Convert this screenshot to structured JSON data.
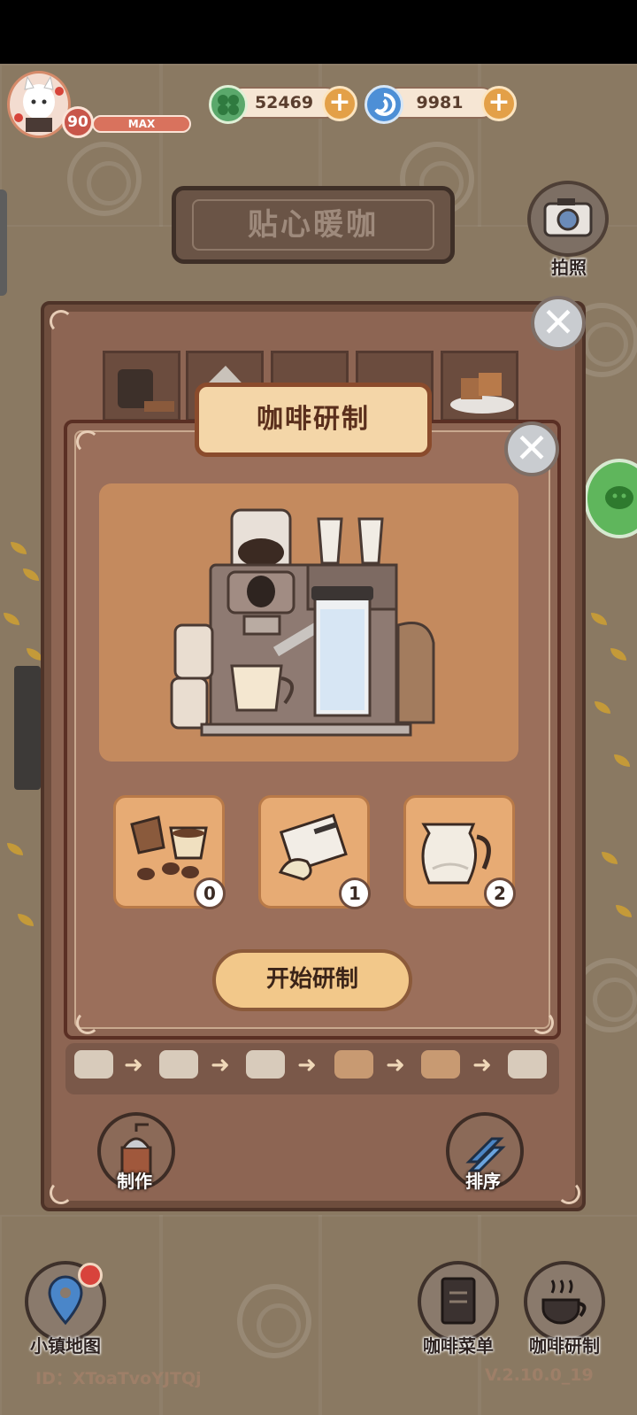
{
  "hud": {
    "level": "90",
    "level_tag": "MAX",
    "currency_leaf": "52469",
    "currency_swirl": "9981"
  },
  "shop_name": "贴心暖咖",
  "camera_label": "拍照",
  "dialog": {
    "title": "咖啡研制",
    "ingredients": [
      {
        "name": "coffee-beans",
        "count": "0"
      },
      {
        "name": "sugar-packet",
        "count": "1"
      },
      {
        "name": "milk-jug",
        "count": "2"
      }
    ],
    "start_label": "开始研制"
  },
  "back_panel": {
    "make_label": "制作",
    "sort_label": "排序"
  },
  "bottom_nav": {
    "map_label": "小镇地图",
    "menu_label": "咖啡菜单",
    "research_label": "咖啡研制"
  },
  "footer": {
    "id_text": "ID：XToaTvoYJTQj",
    "version": "V.2.10.0_19"
  },
  "colors": {
    "panel_brown": "#8d6553",
    "banner_cream": "#f4d6a8",
    "button_orange": "#e3a048"
  }
}
